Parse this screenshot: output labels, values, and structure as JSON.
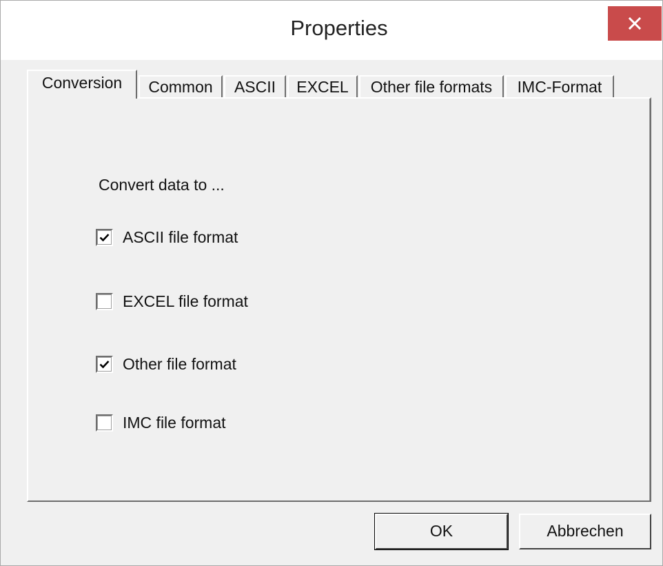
{
  "window": {
    "title": "Properties",
    "close_icon": "close-icon"
  },
  "tabs": [
    {
      "label": "Conversion",
      "active": true
    },
    {
      "label": "Common",
      "active": false
    },
    {
      "label": "ASCII",
      "active": false
    },
    {
      "label": "EXCEL",
      "active": false
    },
    {
      "label": "Other file formats",
      "active": false
    },
    {
      "label": "IMC-Format",
      "active": false
    }
  ],
  "conversion": {
    "group_label": "Convert data to ...",
    "options": [
      {
        "label": "ASCII file format",
        "checked": true
      },
      {
        "label": "EXCEL file format",
        "checked": false
      },
      {
        "label": "Other file format",
        "checked": true
      },
      {
        "label": "IMC file format",
        "checked": false
      }
    ]
  },
  "buttons": {
    "ok_label": "OK",
    "cancel_label": "Abbrechen"
  },
  "colors": {
    "close_button": "#c94b4b",
    "dialog_background": "#f0f0f0"
  }
}
